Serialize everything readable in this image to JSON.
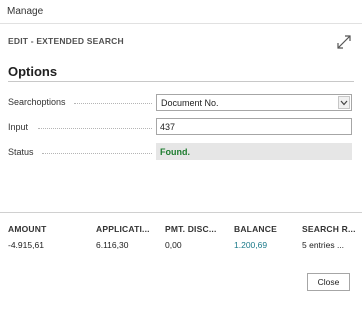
{
  "menu": {
    "manage_label": "Manage"
  },
  "dialog": {
    "title": "EDIT - EXTENDED SEARCH",
    "expand_icon": "expand-diagonal-icon"
  },
  "options": {
    "section_title": "Options",
    "fields": [
      {
        "label": "Searchoptions",
        "type": "select",
        "value": "Document No."
      },
      {
        "label": "Input",
        "type": "text",
        "value": "437"
      },
      {
        "label": "Status",
        "type": "readonly",
        "value": "Found."
      }
    ]
  },
  "grid": {
    "headers": [
      "AMOUNT",
      "APPLICATI...",
      "PMT. DISC...",
      "BALANCE",
      "SEARCH R..."
    ],
    "row": [
      "-4.915,61",
      "6.116,30",
      "0,00",
      "1.200,69",
      "5 entries ..."
    ]
  },
  "footer": {
    "close_label": "Close"
  },
  "colors": {
    "status_found": "#1e7d30",
    "link": "#1b7a8a"
  }
}
